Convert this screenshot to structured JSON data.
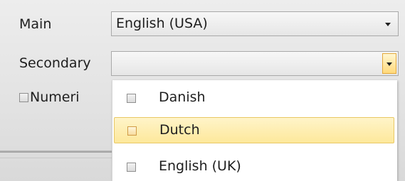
{
  "form": {
    "main_label": "Main",
    "main_value": "English (USA)",
    "secondary_label": "Secondary",
    "secondary_value": "",
    "numeric_label": "Numeri"
  },
  "dropdown": {
    "items": [
      {
        "label": "Danish",
        "checked": false,
        "highlighted": false
      },
      {
        "label": "Dutch",
        "checked": false,
        "highlighted": true
      },
      {
        "label": "English (UK)",
        "checked": false,
        "highlighted": false
      }
    ]
  },
  "colors": {
    "highlight": "#fde89b",
    "dropdown_button": "#ffd97a"
  }
}
